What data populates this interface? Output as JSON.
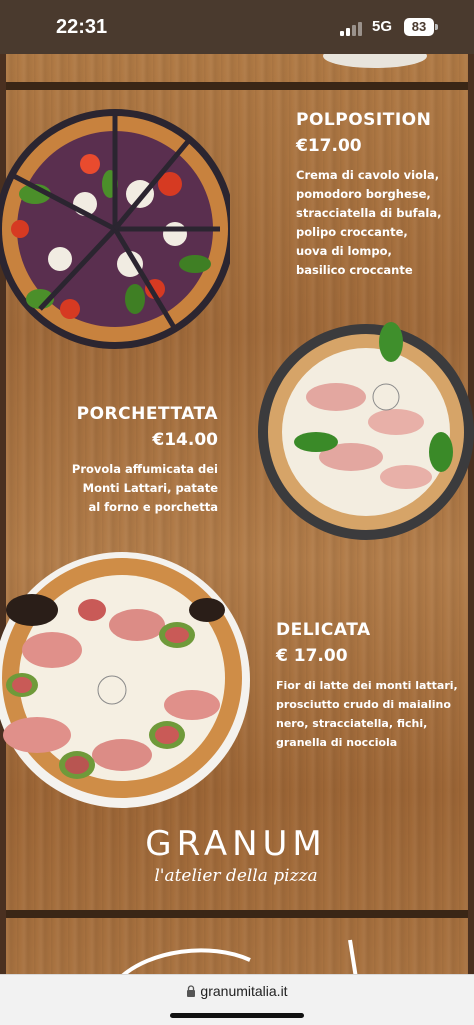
{
  "status_bar": {
    "time": "22:31",
    "network": "5G",
    "battery": "83"
  },
  "menu": {
    "items": [
      {
        "name": "POLPOSITION",
        "price": "€17.00",
        "description_lines": [
          "Crema di cavolo viola,",
          "pomodoro borghese,",
          "stracciatella di bufala,",
          "polipo croccante,",
          "uova di lompo,",
          "basilico croccante"
        ]
      },
      {
        "name": "PORCHETTATA",
        "price": "€14.00",
        "description_lines": [
          "Provola affumicata dei",
          "Monti Lattari, patate",
          "al forno e porchetta"
        ]
      },
      {
        "name": "DELICATA",
        "price": "€ 17.00",
        "description_lines": [
          "Fior di latte dei monti lattari,",
          "prosciutto crudo di maialino",
          "nero, stracciatella, fichi,",
          "granella di nocciola"
        ]
      }
    ],
    "logo": {
      "name": "GRANUM",
      "tagline": "l'atelier della pizza"
    }
  },
  "browser": {
    "url": "granumitalia.it"
  }
}
